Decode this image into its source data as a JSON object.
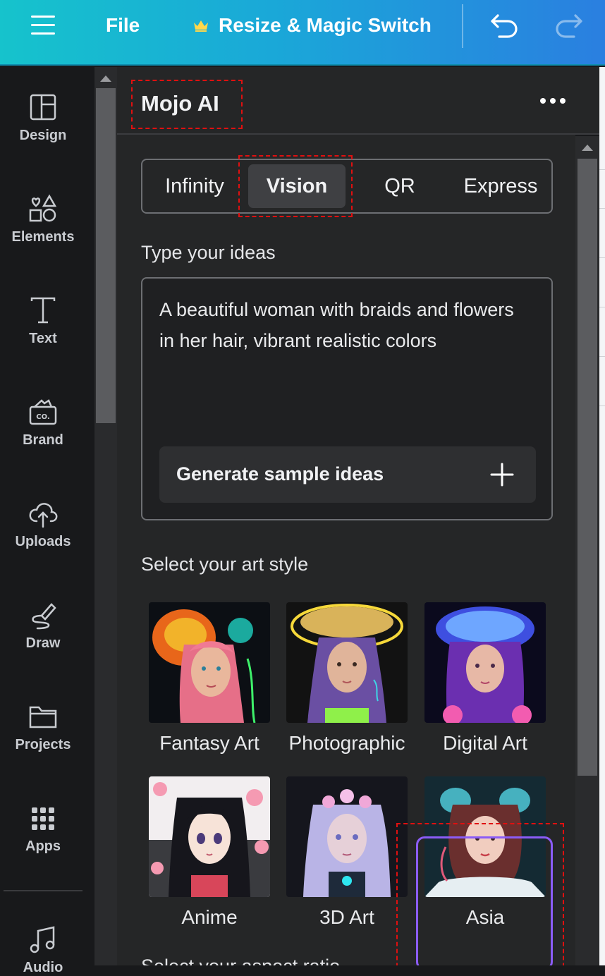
{
  "topbar": {
    "file_label": "File",
    "resize_label": "Resize & Magic Switch"
  },
  "rail": {
    "items": [
      {
        "label": "Design",
        "icon": "layout-icon"
      },
      {
        "label": "Elements",
        "icon": "shapes-icon"
      },
      {
        "label": "Text",
        "icon": "text-icon"
      },
      {
        "label": "Brand",
        "icon": "brand-icon"
      },
      {
        "label": "Uploads",
        "icon": "cloud-upload-icon"
      },
      {
        "label": "Draw",
        "icon": "pen-icon"
      },
      {
        "label": "Projects",
        "icon": "folder-icon"
      },
      {
        "label": "Apps",
        "icon": "grid-icon"
      },
      {
        "label": "Audio",
        "icon": "music-icon"
      }
    ]
  },
  "panel": {
    "title": "Mojo AI",
    "tabs": [
      {
        "label": "Infinity",
        "active": false
      },
      {
        "label": "Vision",
        "active": true
      },
      {
        "label": "QR",
        "active": false
      },
      {
        "label": "Express",
        "active": false
      }
    ],
    "prompt_label": "Type your ideas",
    "prompt_value": "A beautiful woman with braids and flowers in her hair, vibrant realistic colors",
    "generate_label": "Generate sample ideas",
    "style_label": "Select your art style",
    "styles": [
      {
        "label": "Fantasy Art",
        "selected": false
      },
      {
        "label": "Photographic",
        "selected": false
      },
      {
        "label": "Digital Art",
        "selected": false
      },
      {
        "label": "Anime",
        "selected": false
      },
      {
        "label": "3D Art",
        "selected": false
      },
      {
        "label": "Asia",
        "selected": true
      }
    ],
    "next_section_label": "Select your aspect ratio"
  },
  "colors": {
    "accent": "#8b5cf6",
    "annotation": "#e01010",
    "topbar_start": "#16c3cc",
    "topbar_end": "#2a7fe0"
  }
}
